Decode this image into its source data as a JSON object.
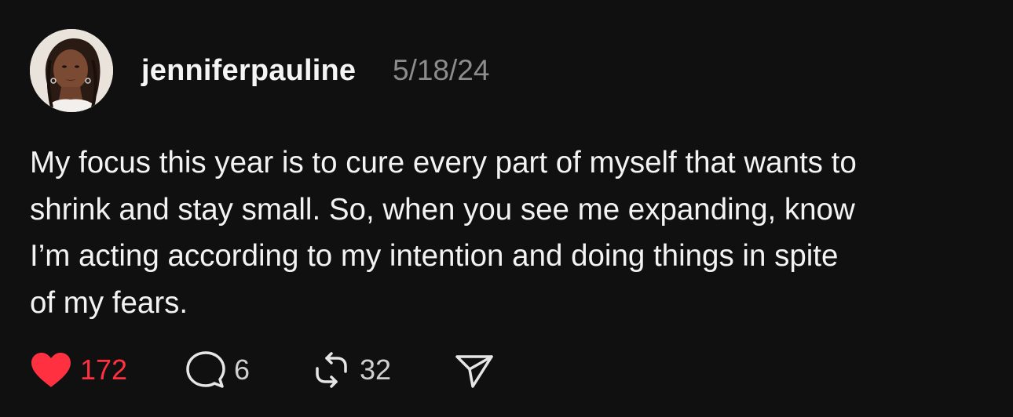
{
  "post": {
    "username": "jenniferpauline",
    "date": "5/18/24",
    "text_lines": [
      "My focus this year is to cure every part of myself that wants to",
      "shrink and stay small. So, when you see me expanding, know",
      "I’m acting according to my intention and doing things in spite",
      "of my fears."
    ],
    "actions": {
      "likes": "172",
      "replies": "6",
      "reposts": "32"
    }
  },
  "icons": {
    "like": "heart-icon",
    "reply": "comment-bubble-icon",
    "repost": "repost-arrows-icon",
    "share": "paper-plane-icon"
  },
  "colors": {
    "background": "#101010",
    "text": "#f3f3f3",
    "muted": "#8c8c8c",
    "like_accent": "#ff3040"
  }
}
